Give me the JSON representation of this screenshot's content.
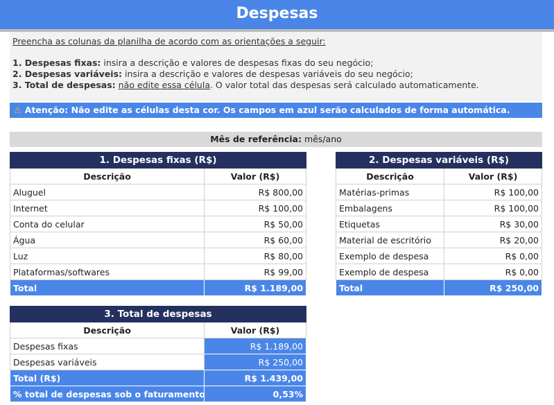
{
  "header": {
    "title": "Despesas"
  },
  "instructions": {
    "intro": "Preencha as colunas da planilha de acordo com as orientações a seguir:",
    "items": [
      {
        "label": "1. Despesas fixas:",
        "text": " insira a descrição e valores de despesas fixas do seu negócio;"
      },
      {
        "label": "2. Despesas variáveis:",
        "text": " insira a descrição e valores de despesas variáveis do seu negócio;"
      },
      {
        "label": "3. Total de despesas:",
        "text_underlined": "não edite essa célula",
        "text_after": ". O valor total das despesas será calculado automaticamente."
      }
    ]
  },
  "warning": {
    "icon": "warning-icon",
    "text": "Atenção: Não edite as células desta cor. Os campos em azul serão calculados de forma automática."
  },
  "reference_month": {
    "label": "Mês de referência:",
    "value": "mês/ano"
  },
  "fixed": {
    "title": "1. Despesas fixas (R$)",
    "col_desc": "Descrição",
    "col_value": "Valor (R$)",
    "rows": [
      {
        "desc": "Aluguel",
        "value": "R$ 800,00"
      },
      {
        "desc": "Internet",
        "value": "R$ 100,00"
      },
      {
        "desc": "Conta do celular",
        "value": "R$ 50,00"
      },
      {
        "desc": "Água",
        "value": "R$ 60,00"
      },
      {
        "desc": "Luz",
        "value": "R$ 80,00"
      },
      {
        "desc": "Plataformas/softwares",
        "value": "R$ 99,00"
      }
    ],
    "total_label": "Total",
    "total_value": "R$ 1.189,00"
  },
  "variable": {
    "title": "2. Despesas variáveis (R$)",
    "col_desc": "Descrição",
    "col_value": "Valor (R$)",
    "rows": [
      {
        "desc": "Matérias-primas",
        "value": "R$ 100,00"
      },
      {
        "desc": "Embalagens",
        "value": "R$ 100,00"
      },
      {
        "desc": "Etiquetas",
        "value": "R$ 30,00"
      },
      {
        "desc": "Material de escritório",
        "value": "R$ 20,00"
      },
      {
        "desc": "Exemplo de despesa",
        "value": "R$ 0,00"
      },
      {
        "desc": "Exemplo de despesa",
        "value": "R$ 0,00"
      }
    ],
    "total_label": "Total",
    "total_value": "R$ 250,00"
  },
  "summary": {
    "title": "3. Total de despesas",
    "col_desc": "Descrição",
    "col_value": "Valor (R$)",
    "rows": [
      {
        "desc": "Despesas fixas",
        "value": "R$ 1.189,00"
      },
      {
        "desc": "Despesas variáveis",
        "value": "R$ 250,00"
      }
    ],
    "total_label": "Total (R$)",
    "total_value": "R$ 1.439,00",
    "pct_label": "% total de despesas sob o faturamento",
    "pct_value": "0,53%"
  },
  "colors": {
    "accent_blue": "#4a86e8",
    "navy": "#24305e",
    "light_gray": "#f2f2f2",
    "mid_gray": "#d9d9d9",
    "warning_icon": "#f6b40e"
  }
}
